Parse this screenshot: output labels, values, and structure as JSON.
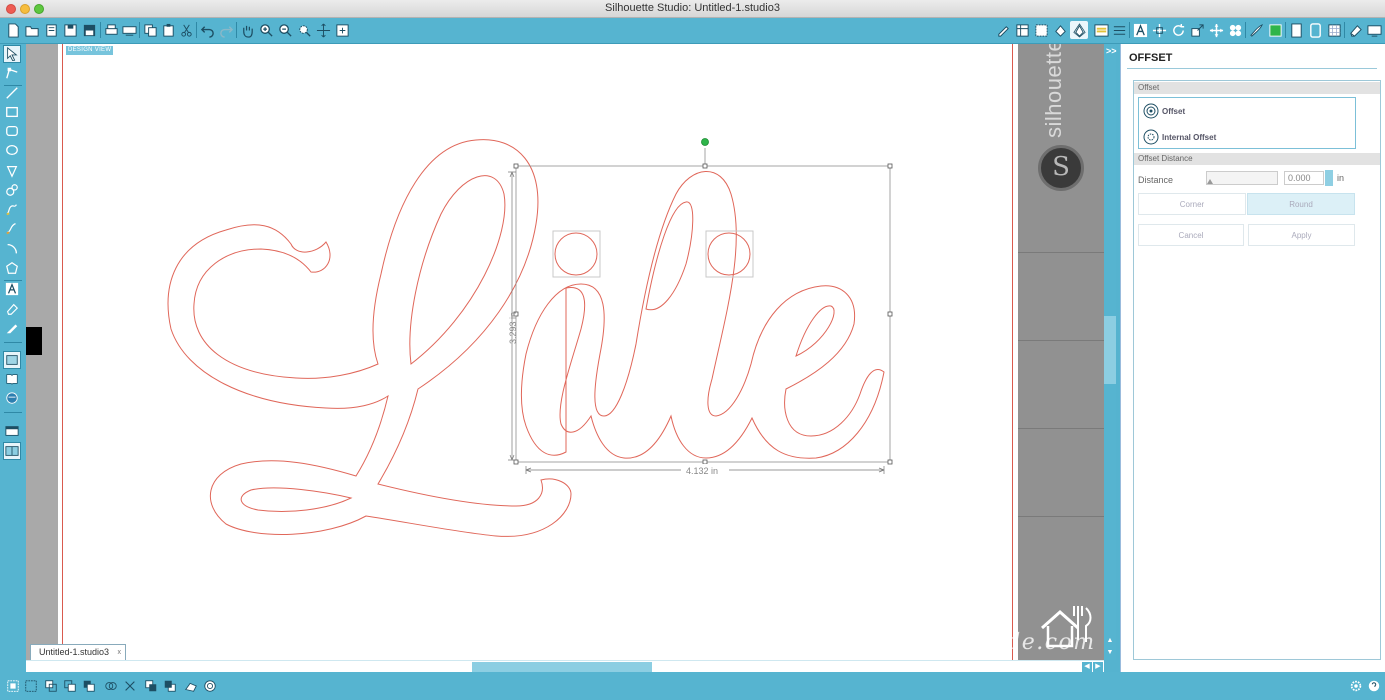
{
  "window": {
    "title": "Silhouette Studio: Untitled-1.studio3"
  },
  "canvas": {
    "view_label": "DESIGN VIEW",
    "brand_text": "silhouette",
    "brand_logo_glyph": "S",
    "watermark": "housefulofhandmade.com"
  },
  "selection": {
    "height_label": "3.293 in",
    "width_label": "4.132 in"
  },
  "artwork": {
    "text": "Lilie",
    "stroke_color": "#e0675a"
  },
  "document_tab": {
    "label": "Untitled-1.studio3",
    "close_glyph": "x"
  },
  "panel": {
    "collapse_glyph": ">>",
    "title": "OFFSET",
    "offset_section": "Offset",
    "offset_option": "Offset",
    "internal_offset_option": "Internal Offset",
    "distance_section": "Offset Distance",
    "distance_label": "Distance",
    "distance_value": "0.000",
    "distance_unit": "in",
    "corner_label": "Corner",
    "round_label": "Round",
    "cancel_label": "Cancel",
    "apply_label": "Apply"
  },
  "colors": {
    "accent": "#56b4d0",
    "cut_line": "#d95a4e",
    "handle_green": "#2fb54a"
  },
  "toolbar_icons": [
    "new-file-icon",
    "open-folder-icon",
    "open-library-icon",
    "save-icon",
    "save-as-icon",
    "print-icon",
    "send-to-cutter-icon",
    "copy-icon",
    "paste-icon",
    "cut-icon",
    "undo-icon",
    "redo-icon",
    "pan-hand-icon",
    "zoom-in-icon",
    "zoom-out-icon",
    "zoom-selection-icon",
    "move-view-icon",
    "fit-page-icon"
  ],
  "right_toolbar_icons": [
    "page-setup-icon",
    "grid-icon",
    "registration-icon",
    "fill-icon",
    "offset-panel-icon",
    "line-color-icon",
    "line-style-icon",
    "text-style-icon",
    "transform-icon",
    "rotate-icon",
    "scale-icon",
    "move-icon",
    "replicate-icon",
    "knife-icon",
    "trace-icon",
    "library-icon",
    "store-icon",
    "cut-settings-icon",
    "eraser-icon",
    "send-icon"
  ],
  "left_tools": [
    "select-icon",
    "point-edit-icon",
    "line-tool-icon",
    "rectangle-icon",
    "rounded-rect-icon",
    "ellipse-icon",
    "polygon-icon",
    "curve-icon",
    "freehand-icon",
    "smooth-freehand-icon",
    "arc-icon",
    "regular-polygon-icon",
    "text-tool-icon",
    "eraser-tool-icon",
    "knife-tool-icon",
    "draw-window-icon",
    "library-panel-icon",
    "store-panel-icon",
    "design-view-icon",
    "split-view-icon"
  ],
  "bottom_icons": [
    "group-icon",
    "ungroup-icon",
    "make-compound-icon",
    "release-compound-icon",
    "weld-icon",
    "select-all-icon",
    "deselect-icon",
    "bring-forward-icon",
    "send-backward-icon",
    "erase-area-icon",
    "offset-icon"
  ],
  "bottom_right_icons": [
    "settings-gear-icon",
    "help-icon"
  ]
}
